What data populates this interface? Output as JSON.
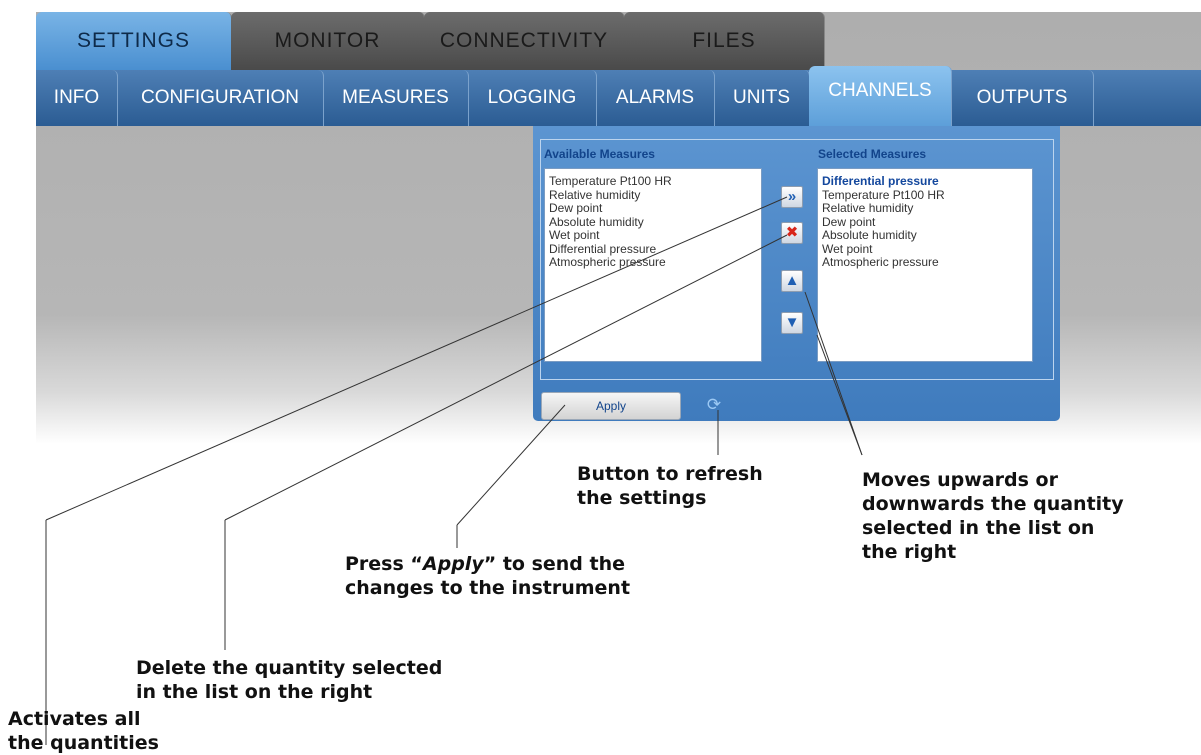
{
  "top_tabs": [
    "SETTINGS",
    "MONITOR",
    "CONNECTIVITY",
    "FILES"
  ],
  "sub_tabs": [
    "INFO",
    "CONFIGURATION",
    "MEASURES",
    "LOGGING",
    "ALARMS",
    "UNITS",
    "CHANNELS",
    "OUTPUTS"
  ],
  "channels": {
    "available_title": "Available Measures",
    "selected_title": "Selected Measures",
    "available": [
      "Temperature Pt100 HR",
      "Relative humidity",
      "Dew point",
      "Absolute humidity",
      "Wet point",
      "Differential pressure",
      "Atmospheric pressure"
    ],
    "selected": [
      "Differential pressure",
      "Temperature Pt100 HR",
      "Relative humidity",
      "Dew point",
      "Absolute humidity",
      "Wet point",
      "Atmospheric pressure"
    ],
    "icons": {
      "add_all": "double-chevron-right-icon",
      "delete": "red-x-icon",
      "move_up": "arrow-up-icon",
      "move_down": "arrow-down-icon",
      "refresh": "refresh-icon"
    },
    "apply_label": "Apply"
  },
  "callouts": {
    "refresh": "Button to refresh\nthe settings",
    "move": "Moves upwards or\ndownwards the quantity\nselected in the list on\nthe right",
    "apply_prefix": "Press “",
    "apply_word": "Apply",
    "apply_suffix": "” to send the\nchanges to the instrument",
    "delete": "Delete the quantity selected\nin the list on the right",
    "activate": "Activates all\nthe quantities"
  },
  "colors": {
    "active_tab": "#5d9fd9",
    "subtab_bar": "#2b5c93",
    "panel": "#4a85c6",
    "delete_icon": "#d8261a"
  }
}
